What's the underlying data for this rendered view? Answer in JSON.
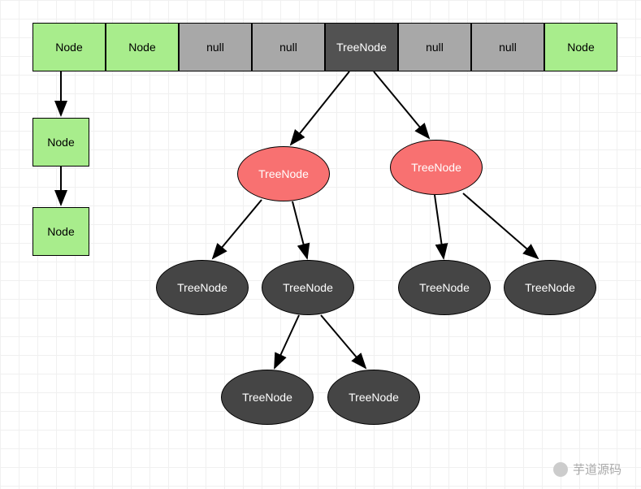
{
  "array": {
    "cells": [
      {
        "label": "Node",
        "type": "green"
      },
      {
        "label": "Node",
        "type": "green"
      },
      {
        "label": "null",
        "type": "gray"
      },
      {
        "label": "null",
        "type": "gray"
      },
      {
        "label": "TreeNode",
        "type": "dark"
      },
      {
        "label": "null",
        "type": "gray"
      },
      {
        "label": "null",
        "type": "gray"
      },
      {
        "label": "Node",
        "type": "green"
      }
    ]
  },
  "leftChain": {
    "node1": "Node",
    "node2": "Node"
  },
  "tree": {
    "redLeft": "TreeNode",
    "redRight": "TreeNode",
    "darkL1": "TreeNode",
    "darkL2": "TreeNode",
    "darkR1": "TreeNode",
    "darkR2": "TreeNode",
    "darkB1": "TreeNode",
    "darkB2": "TreeNode"
  },
  "watermark": {
    "text": "芋道源码"
  },
  "colors": {
    "green": "#a8ed8c",
    "grayCell": "#a8a8a8",
    "darkCell": "#525252",
    "redEllipse": "#f87171",
    "darkEllipse": "#454545"
  }
}
